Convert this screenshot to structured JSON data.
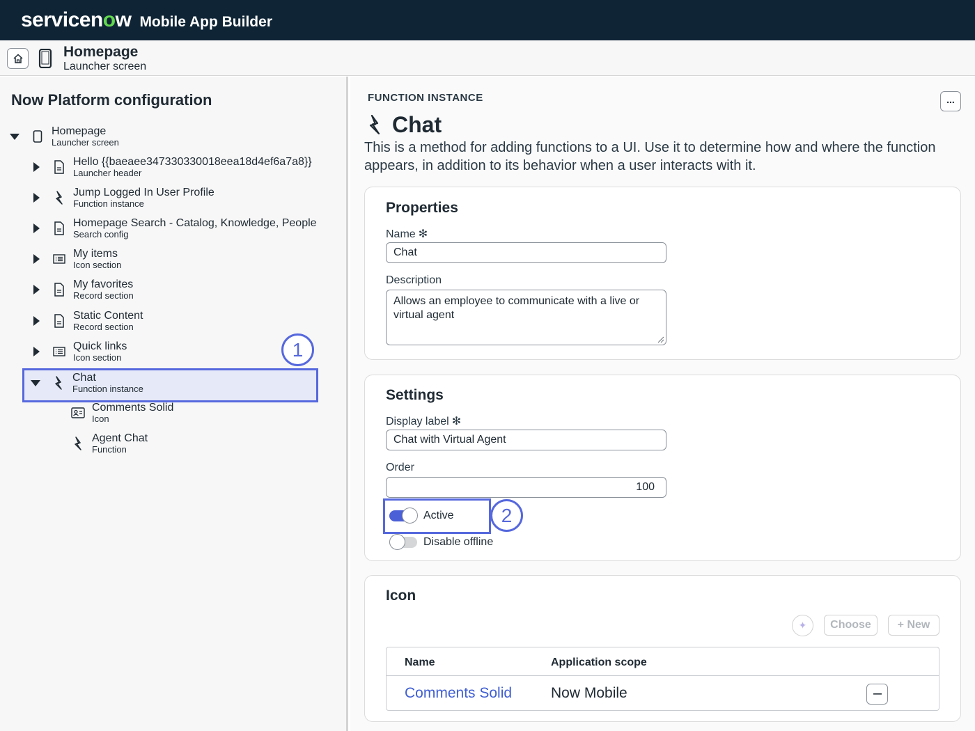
{
  "topbar": {
    "brand_prefix": "servicen",
    "brand_o": "o",
    "brand_suffix": "w",
    "app_name": "Mobile App Builder"
  },
  "subheader": {
    "title": "Homepage",
    "subtitle": "Launcher screen"
  },
  "left": {
    "title": "Now Platform configuration",
    "tree": [
      {
        "label": "Homepage",
        "type": "Launcher screen",
        "icon": "phone-icon",
        "expanded": true
      },
      {
        "label": "Hello {{baeaee347330330018eea18d4ef6a7a8}}",
        "type": "Launcher header",
        "icon": "document-icon"
      },
      {
        "label": "Jump Logged In User Profile",
        "type": "Function instance",
        "icon": "bolt-icon"
      },
      {
        "label": "Homepage Search - Catalog, Knowledge, People",
        "type": "Search config",
        "icon": "document-icon"
      },
      {
        "label": "My items",
        "type": "Icon section",
        "icon": "list-icon"
      },
      {
        "label": "My favorites",
        "type": "Record section",
        "icon": "document-icon"
      },
      {
        "label": "Static Content",
        "type": "Record section",
        "icon": "document-icon"
      },
      {
        "label": "Quick links",
        "type": "Icon section",
        "icon": "list-icon"
      },
      {
        "label": "Chat",
        "type": "Function instance",
        "icon": "bolt-icon",
        "expanded": true,
        "selected": true
      },
      {
        "label": "Comments Solid",
        "type": "Icon",
        "icon": "contact-card-icon"
      },
      {
        "label": "Agent Chat",
        "type": "Function",
        "icon": "bolt-icon"
      }
    ]
  },
  "callouts": {
    "one": "1",
    "two": "2"
  },
  "detail": {
    "section_label": "FUNCTION INSTANCE",
    "more_label": "...",
    "title": "Chat",
    "description": "This is a method for adding functions to a UI. Use it to determine how and where the function appears, in addition to its behavior when a user interacts with it.",
    "properties": {
      "title": "Properties",
      "name_label": "Name",
      "name_value": "Chat",
      "description_label": "Description",
      "description_value": "Allows an employee to communicate with a live or virtual agent"
    },
    "settings": {
      "title": "Settings",
      "display_label_label": "Display label",
      "display_label_value": "Chat with Virtual Agent",
      "order_label": "Order",
      "order_value": "100",
      "active_label": "Active",
      "active_on": true,
      "offline_label": "Disable offline",
      "offline_on": false
    },
    "icon_section": {
      "title": "Icon",
      "choose_label": "Choose",
      "new_label": "+ New",
      "columns": [
        "Name",
        "Application scope"
      ],
      "rows": [
        {
          "name": "Comments Solid",
          "scope": "Now Mobile"
        }
      ]
    },
    "required_mark": "✻"
  },
  "colors": {
    "header_bg": "#0f2536",
    "accent": "#5668dd",
    "brand_green": "#62d84e",
    "link": "#3f5ed3"
  }
}
